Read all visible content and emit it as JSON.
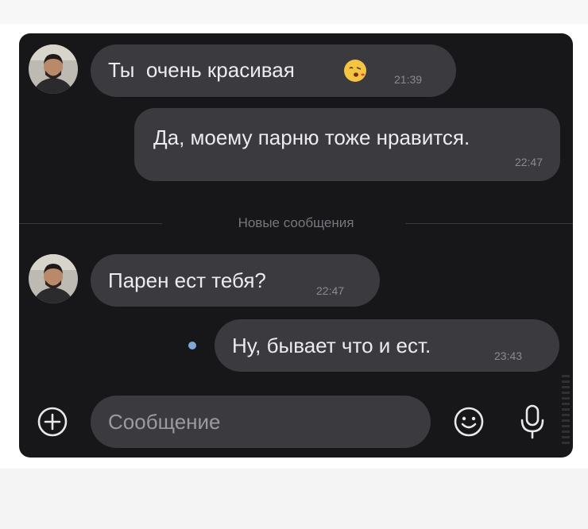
{
  "messages": [
    {
      "from": "other",
      "text": "Ты  очень красивая",
      "emoji": "kiss-face-icon",
      "time": "21:39"
    },
    {
      "from": "me",
      "text": "Да, моему парню тоже нравится.",
      "time": "22:47"
    },
    {
      "from": "other",
      "text": "Парен ест тебя?",
      "time": "22:47"
    },
    {
      "from": "me",
      "text": "Ну, бывает что и ест.",
      "time": "23:43",
      "unread": true
    }
  ],
  "divider": {
    "label": "Новые сообщения"
  },
  "composer": {
    "placeholder": "Сообщение"
  },
  "icons": {
    "attach": "plus-circle-icon",
    "emoji": "smiley-icon",
    "voice": "microphone-icon"
  },
  "colors": {
    "window_bg": "#17171a",
    "bubble_bg": "#3a3a3f",
    "text": "#ececee",
    "time": "#8a8a90",
    "unread_dot": "#7fa7d8"
  }
}
